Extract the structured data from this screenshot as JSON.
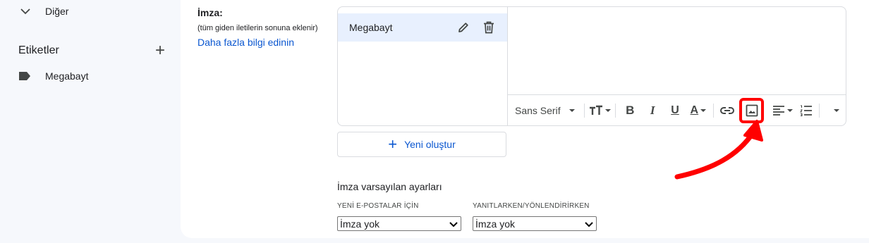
{
  "sidebar": {
    "more_label": "Diğer",
    "labels_heading": "Etiketler",
    "labels": [
      {
        "label": "Megabayt"
      }
    ]
  },
  "signature": {
    "title": "İmza:",
    "subtitle": "(tüm giden iletilerin sonuna eklenir)",
    "learn_more": "Daha fazla bilgi edinin",
    "items": [
      {
        "name": "Megabayt"
      }
    ],
    "new_button": "Yeni oluştur"
  },
  "toolbar": {
    "font": "Sans Serif",
    "bold": "B",
    "italic": "I",
    "underline": "U",
    "text_color": "A"
  },
  "defaults": {
    "title": "İmza varsayılan ayarları",
    "new_emails_label": "YENİ E-POSTALAR İÇİN",
    "new_emails_value": "İmza yok",
    "replies_label": "YANITLARKEN/YÖNLENDİRİRKEN",
    "replies_value": "İmza yok"
  },
  "colors": {
    "accent": "#0b57d0",
    "highlight": "#ff0000",
    "selected_bg": "#e8f0fe"
  }
}
